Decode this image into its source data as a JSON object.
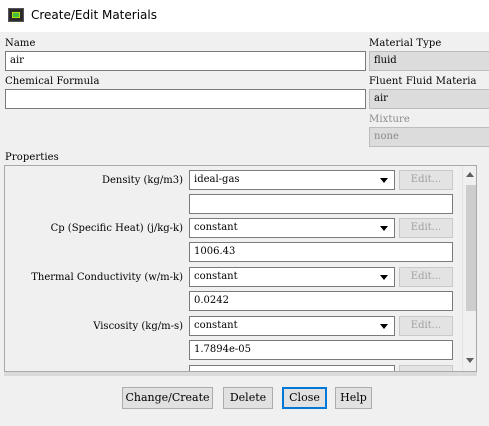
{
  "window": {
    "title": "Create/Edit Materials"
  },
  "left": {
    "name_label": "Name",
    "name_value": "air",
    "formula_label": "Chemical Formula",
    "formula_value": ""
  },
  "right": {
    "material_type_label": "Material Type",
    "material_type_value": "fluid",
    "fluent_materials_label": "Fluent Fluid Materia",
    "fluent_materials_value": "air",
    "mixture_label": "Mixture",
    "mixture_value": "none"
  },
  "properties": {
    "section_label": "Properties",
    "edit_label": "Edit...",
    "items": [
      {
        "label": "Density (kg/m3)",
        "method": "ideal-gas",
        "value": ""
      },
      {
        "label": "Cp (Specific Heat) (j/kg-k)",
        "method": "constant",
        "value": "1006.43"
      },
      {
        "label": "Thermal Conductivity (w/m-k)",
        "method": "constant",
        "value": "0.0242"
      },
      {
        "label": "Viscosity (kg/m-s)",
        "method": "constant",
        "value": "1.7894e-05"
      }
    ]
  },
  "buttons": {
    "change_create": "Change/Create",
    "delete": "Delete",
    "close": "Close",
    "help": "Help"
  },
  "colors": {
    "focus_border": "#0078d7",
    "window_bg": "#f0f0f0",
    "disabled_field_bg": "#dcdcdc"
  }
}
